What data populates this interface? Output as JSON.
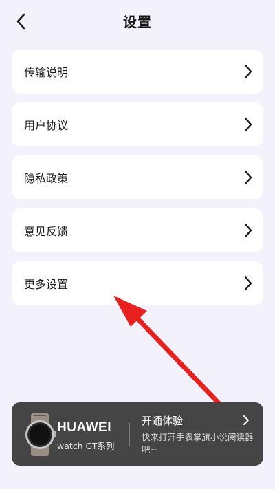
{
  "header": {
    "title": "设置",
    "back_icon": "chevron-left-icon"
  },
  "settings": {
    "items": [
      {
        "label": "传输说明",
        "icon": "chevron-right-icon"
      },
      {
        "label": "用户协议",
        "icon": "chevron-right-icon"
      },
      {
        "label": "隐私政策",
        "icon": "chevron-right-icon"
      },
      {
        "label": "意见反馈",
        "icon": "chevron-right-icon"
      },
      {
        "label": "更多设置",
        "icon": "chevron-right-icon"
      }
    ]
  },
  "annotation": {
    "color": "#e8211f",
    "icon": "red-arrow"
  },
  "promo": {
    "brand": "HUAWEI",
    "model": "watch GT系列",
    "title": "开通体验",
    "description": "快来打开手表掌旗小说阅读器吧~",
    "background": "#454545",
    "icon": "chevron-right-icon"
  },
  "colors": {
    "page_background": "#f3f1fb",
    "card": "#ffffff"
  }
}
